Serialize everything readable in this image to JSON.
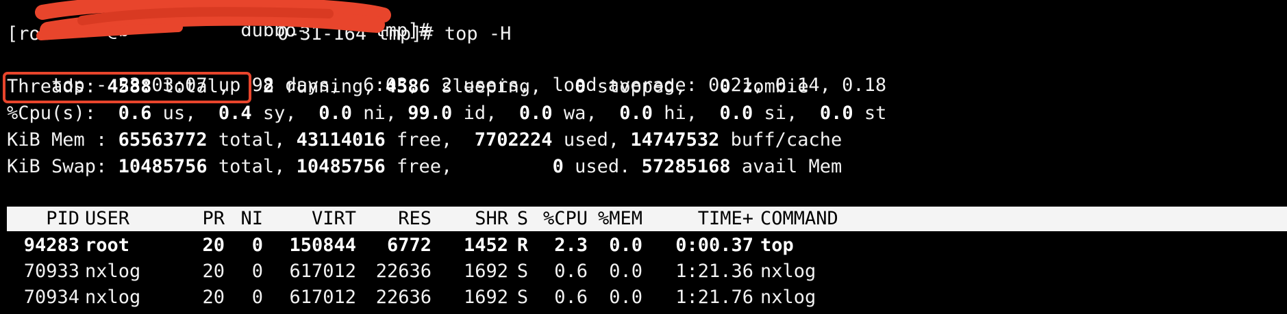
{
  "prompt": {
    "line1": "[root@b          dubbo-      tmp]#",
    "line2_prefix": "[roo",
    "line2_suffix": "0-31-164 tmp]# top -H"
  },
  "summary": {
    "uptime": "top - 23:03:07 up 98 days,  6:03,  2 users,  load average: 0.21, 0.14, 0.18",
    "threads_label": "Threads:",
    "threads_total": "4588",
    "threads_total_label": "total,",
    "threads_running": "2",
    "threads_running_label": "running,",
    "threads_sleeping": "4586",
    "threads_sleeping_label": "sleeping,",
    "threads_stopped": "0",
    "threads_stopped_label": "stopped,",
    "threads_zombie": "0",
    "threads_zombie_label": "zombie",
    "cpu_label": "%Cpu(s):",
    "cpu_us": "0.6",
    "cpu_sy": "0.4",
    "cpu_ni": "0.0",
    "cpu_id": "99.0",
    "cpu_wa": "0.0",
    "cpu_hi": "0.0",
    "cpu_si": "0.0",
    "cpu_st": "0.0",
    "mem_label": "KiB Mem :",
    "mem_total": "65563772",
    "mem_free": "43114016",
    "mem_used": "7702224",
    "mem_buff": "14747532",
    "swap_label": "KiB Swap:",
    "swap_total": "10485756",
    "swap_free": "10485756",
    "swap_used": "0",
    "swap_avail": "57285168"
  },
  "columns": {
    "pid": "PID",
    "user": "USER",
    "pr": "PR",
    "ni": "NI",
    "virt": "VIRT",
    "res": "RES",
    "shr": "SHR",
    "s": "S",
    "cpu": "%CPU",
    "mem": "%MEM",
    "time": "TIME+",
    "command": "COMMAND"
  },
  "processes": [
    {
      "pid": "94283",
      "user": "root",
      "pr": "20",
      "ni": "0",
      "virt": "150844",
      "res": "6772",
      "shr": "1452",
      "s": "R",
      "cpu": "2.3",
      "mem": "0.0",
      "time": "0:00.37",
      "command": "top"
    },
    {
      "pid": "70933",
      "user": "nxlog",
      "pr": "20",
      "ni": "0",
      "virt": "617012",
      "res": "22636",
      "shr": "1692",
      "s": "S",
      "cpu": "0.6",
      "mem": "0.0",
      "time": "1:21.36",
      "command": "nxlog"
    },
    {
      "pid": "70934",
      "user": "nxlog",
      "pr": "20",
      "ni": "0",
      "virt": "617012",
      "res": "22636",
      "shr": "1692",
      "s": "S",
      "cpu": "0.6",
      "mem": "0.0",
      "time": "1:21.76",
      "command": "nxlog"
    }
  ],
  "colors": {
    "background": "#000000",
    "text": "#f2f2f2",
    "header_bg": "#f4f4f4",
    "annotation_red": "#e8452c"
  }
}
